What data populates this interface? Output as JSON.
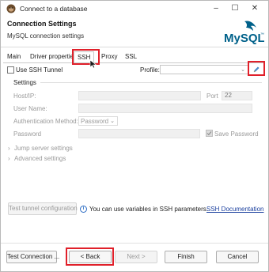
{
  "window": {
    "title": "Connect to a database",
    "controls": {
      "minimize": "–",
      "maximize": "☐",
      "close": "✕"
    }
  },
  "header": {
    "title": "Connection Settings",
    "subtitle": "MySQL connection settings",
    "logo_text": "MySQL",
    "logo_mark": "™"
  },
  "tabs": [
    {
      "label": "Main"
    },
    {
      "label": "Driver properties"
    },
    {
      "label": "SSH",
      "selected": true
    },
    {
      "label": "Proxy"
    },
    {
      "label": "SSL"
    }
  ],
  "ssh": {
    "use_tunnel_label": "Use SSH Tunnel",
    "use_tunnel_checked": false,
    "profile_label": "Profile:",
    "profile_value": "",
    "edit_profile_icon": "pencil-icon"
  },
  "settings": {
    "group_label": "Settings",
    "host_label": "Host/IP:",
    "host_value": "",
    "port_label": "Port",
    "port_value": "22",
    "username_label": "User Name:",
    "username_value": "",
    "auth_label": "Authentication Method:",
    "auth_value": "Password",
    "password_label": "Password",
    "password_value": "",
    "save_password_label": "Save Password",
    "save_password_checked": true
  },
  "sections": {
    "jump_server": "Jump server settings",
    "advanced": "Advanced settings"
  },
  "bottom": {
    "test_tunnel_button": "Test tunnel configuration",
    "info_text": "You can use variables in SSH parameters.",
    "doc_link": "SSH Documentation"
  },
  "footer": {
    "test_connection": "Test Connection ...",
    "back": "< Back",
    "next": "Next >",
    "finish": "Finish",
    "cancel": "Cancel"
  },
  "colors": {
    "highlight": "#e0202a",
    "link": "#1a3f9e",
    "mysql_blue": "#00618a",
    "mysql_orange": "#e48e00"
  }
}
